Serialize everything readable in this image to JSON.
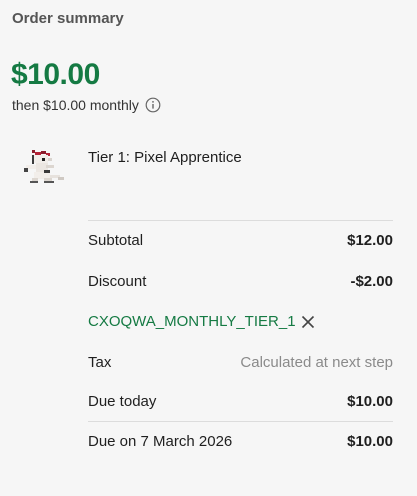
{
  "summary": {
    "title": "Order summary",
    "price": "$10.00",
    "recurring_text": "then $10.00 monthly"
  },
  "product": {
    "name": "Tier 1: Pixel Apprentice"
  },
  "lines": {
    "subtotal_label": "Subtotal",
    "subtotal_value": "$12.00",
    "discount_label": "Discount",
    "discount_value": "-$2.00",
    "coupon_code": "CXOQWA_MONTHLY_TIER_1",
    "tax_label": "Tax",
    "tax_value": "Calculated at next step",
    "due_today_label": "Due today",
    "due_today_value": "$10.00",
    "due_later_label": "Due on 7 March 2026",
    "due_later_value": "$10.00"
  },
  "colors": {
    "accent_green": "#157a43"
  }
}
